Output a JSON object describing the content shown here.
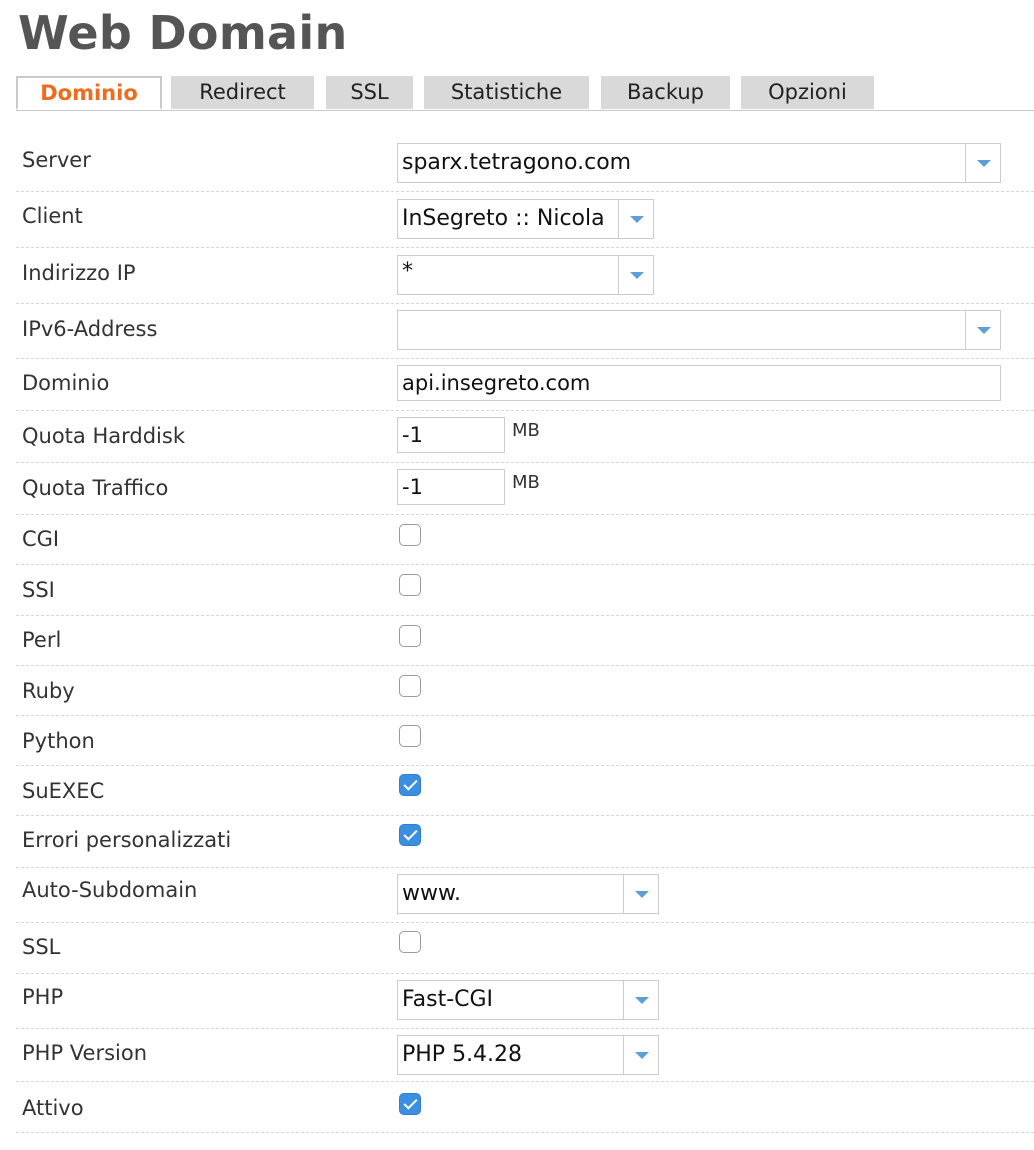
{
  "page": {
    "title": "Web Domain"
  },
  "tabs": [
    {
      "label": "Dominio",
      "active": true
    },
    {
      "label": "Redirect",
      "active": false
    },
    {
      "label": "SSL",
      "active": false
    },
    {
      "label": "Statistiche",
      "active": false
    },
    {
      "label": "Backup",
      "active": false
    },
    {
      "label": "Opzioni",
      "active": false
    }
  ],
  "form": {
    "server": {
      "label": "Server",
      "value": "sparx.tetragono.com"
    },
    "client": {
      "label": "Client",
      "value": "InSegreto :: Nicola"
    },
    "ip": {
      "label": "Indirizzo IP",
      "value": "*"
    },
    "ipv6": {
      "label": "IPv6-Address",
      "value": ""
    },
    "domain": {
      "label": "Dominio",
      "value": "api.insegreto.com"
    },
    "quota_hd": {
      "label": "Quota Harddisk",
      "value": "-1",
      "unit": "MB"
    },
    "quota_traffic": {
      "label": "Quota Traffico",
      "value": "-1",
      "unit": "MB"
    },
    "cgi": {
      "label": "CGI",
      "checked": false
    },
    "ssi": {
      "label": "SSI",
      "checked": false
    },
    "perl": {
      "label": "Perl",
      "checked": false
    },
    "ruby": {
      "label": "Ruby",
      "checked": false
    },
    "python": {
      "label": "Python",
      "checked": false
    },
    "suexec": {
      "label": "SuEXEC",
      "checked": true
    },
    "errors": {
      "label": "Errori personalizzati",
      "checked": true
    },
    "autosub": {
      "label": "Auto-Subdomain",
      "value": "www."
    },
    "ssl": {
      "label": "SSL",
      "checked": false
    },
    "php": {
      "label": "PHP",
      "value": "Fast-CGI"
    },
    "php_version": {
      "label": "PHP Version",
      "value": "PHP 5.4.28"
    },
    "active": {
      "label": "Attivo",
      "checked": true
    }
  },
  "colors": {
    "accent": "#ef6c1e",
    "check": "#3b8fe0",
    "arrow": "#5b9fd6"
  }
}
